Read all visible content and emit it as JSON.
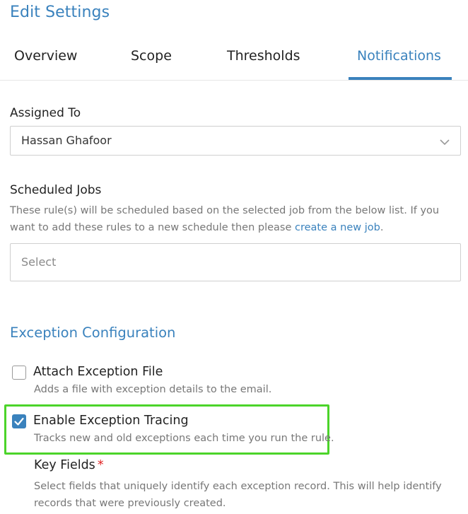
{
  "page": {
    "title": "Edit Settings"
  },
  "tabs": [
    {
      "label": "Overview",
      "active": false
    },
    {
      "label": "Scope",
      "active": false
    },
    {
      "label": "Thresholds",
      "active": false
    },
    {
      "label": "Notifications",
      "active": true
    }
  ],
  "assigned_to": {
    "label": "Assigned To",
    "value": "Hassan Ghafoor"
  },
  "scheduled_jobs": {
    "label": "Scheduled Jobs",
    "description_prefix": "These rule(s) will be scheduled based on the selected job from the below list. If you want to add these rules to a new schedule then please",
    "link_text": "create a new job",
    "description_suffix": ".",
    "placeholder": "Select"
  },
  "exception_configuration": {
    "title": "Exception Configuration",
    "attach_file": {
      "label": "Attach Exception File",
      "description": "Adds a file with exception details to the email.",
      "checked": false
    },
    "enable_tracing": {
      "label": "Enable Exception Tracing",
      "description": "Tracks new and old exceptions each time you run the rule.",
      "checked": true
    },
    "key_fields": {
      "label": "Key Fields",
      "required_mark": "*",
      "description": "Select fields that uniquely identify each exception record. This will help identify records that were previously created."
    }
  },
  "colors": {
    "accent": "#3a82bd",
    "highlight": "#4cd42a",
    "required": "#e02424"
  }
}
